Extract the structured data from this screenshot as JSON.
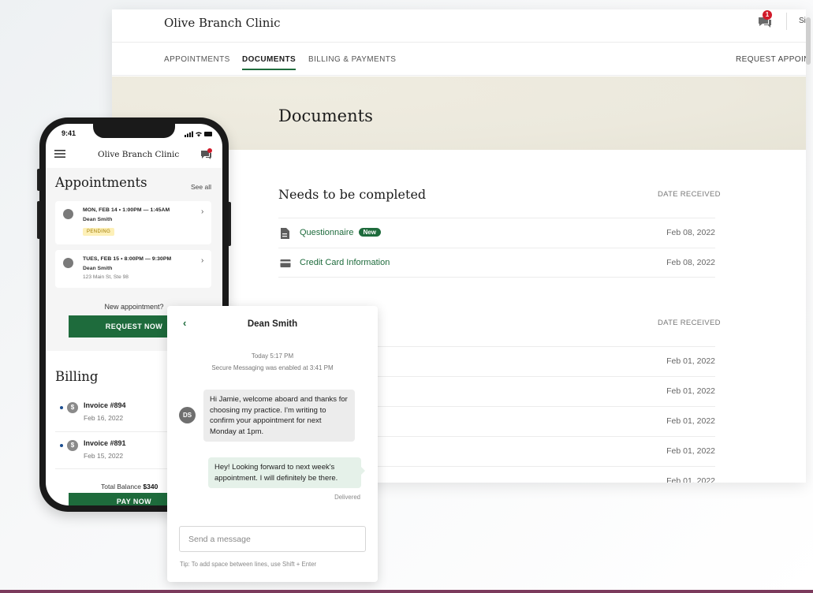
{
  "desktop": {
    "clinic_name": "Olive Branch Clinic",
    "notification_count": "1",
    "signout_label": "Si",
    "nav": {
      "appointments": "APPOINTMENTS",
      "documents": "DOCUMENTS",
      "billing": "BILLING & PAYMENTS",
      "request": "REQUEST APPOINT"
    },
    "page_title": "Documents",
    "sections": [
      {
        "title": "Needs to be completed",
        "date_header": "DATE RECEIVED",
        "rows": [
          {
            "name": "Questionnaire",
            "badge": "New",
            "date": "Feb 08, 2022",
            "icon": "document-icon"
          },
          {
            "name": "Credit Card Information",
            "date": "Feb 08, 2022",
            "icon": "credit-card-icon"
          }
        ]
      },
      {
        "date_header": "DATE RECEIVED",
        "rows": [
          {
            "date": "Feb 01, 2022"
          },
          {
            "date": "Feb 01, 2022"
          },
          {
            "date": "Feb 01, 2022"
          },
          {
            "date": "Feb 01, 2022"
          },
          {
            "date": "Feb 01, 2022"
          }
        ]
      }
    ]
  },
  "phone": {
    "status_time": "9:41",
    "clinic_name": "Olive Branch Clinic",
    "appointments_title": "Appointments",
    "see_all": "See all",
    "appointments": [
      {
        "when": "MON, FEB 14 • 1:00PM — 1:45AM",
        "who": "Dean Smith",
        "status": "PENDING",
        "icon": "video-icon"
      },
      {
        "when": "TUES, FEB 15 • 8:00PM — 9:30PM",
        "who": "Dean Smith",
        "address": "123 Main St, Ste 98",
        "icon": "location-icon"
      }
    ],
    "new_appointment": "New appointment?",
    "request_now": "REQUEST NOW",
    "billing_title": "Billing",
    "invoices": [
      {
        "name": "Invoice #894",
        "date": "Feb 16, 2022"
      },
      {
        "name": "Invoice #891",
        "date": "Feb 15, 2022"
      }
    ],
    "total_label": "Total Balance",
    "total_amount": "$340",
    "pay_now": "PAY NOW"
  },
  "chat": {
    "contact_name": "Dean Smith",
    "timestamp": "Today 5:17 PM",
    "system_message": "Secure Messaging was enabled at 3:41 PM",
    "avatar_initials": "DS",
    "incoming_message": "Hi Jamie, welcome aboard and thanks for choosing my practice. I'm writing to confirm your appointment for next Monday at 1pm.",
    "outgoing_message": "Hey! Looking forward to next week's appointment. I will definitely be there.",
    "delivered_label": "Delivered",
    "input_placeholder": "Send a message",
    "tip": "Tip: To add space between lines, use Shift + Enter"
  },
  "colors": {
    "brand_green": "#1e6b3c",
    "banner_beige": "#ece9dd",
    "badge_red": "#d11a2a",
    "pending_yellow": "#fdf0b8"
  }
}
